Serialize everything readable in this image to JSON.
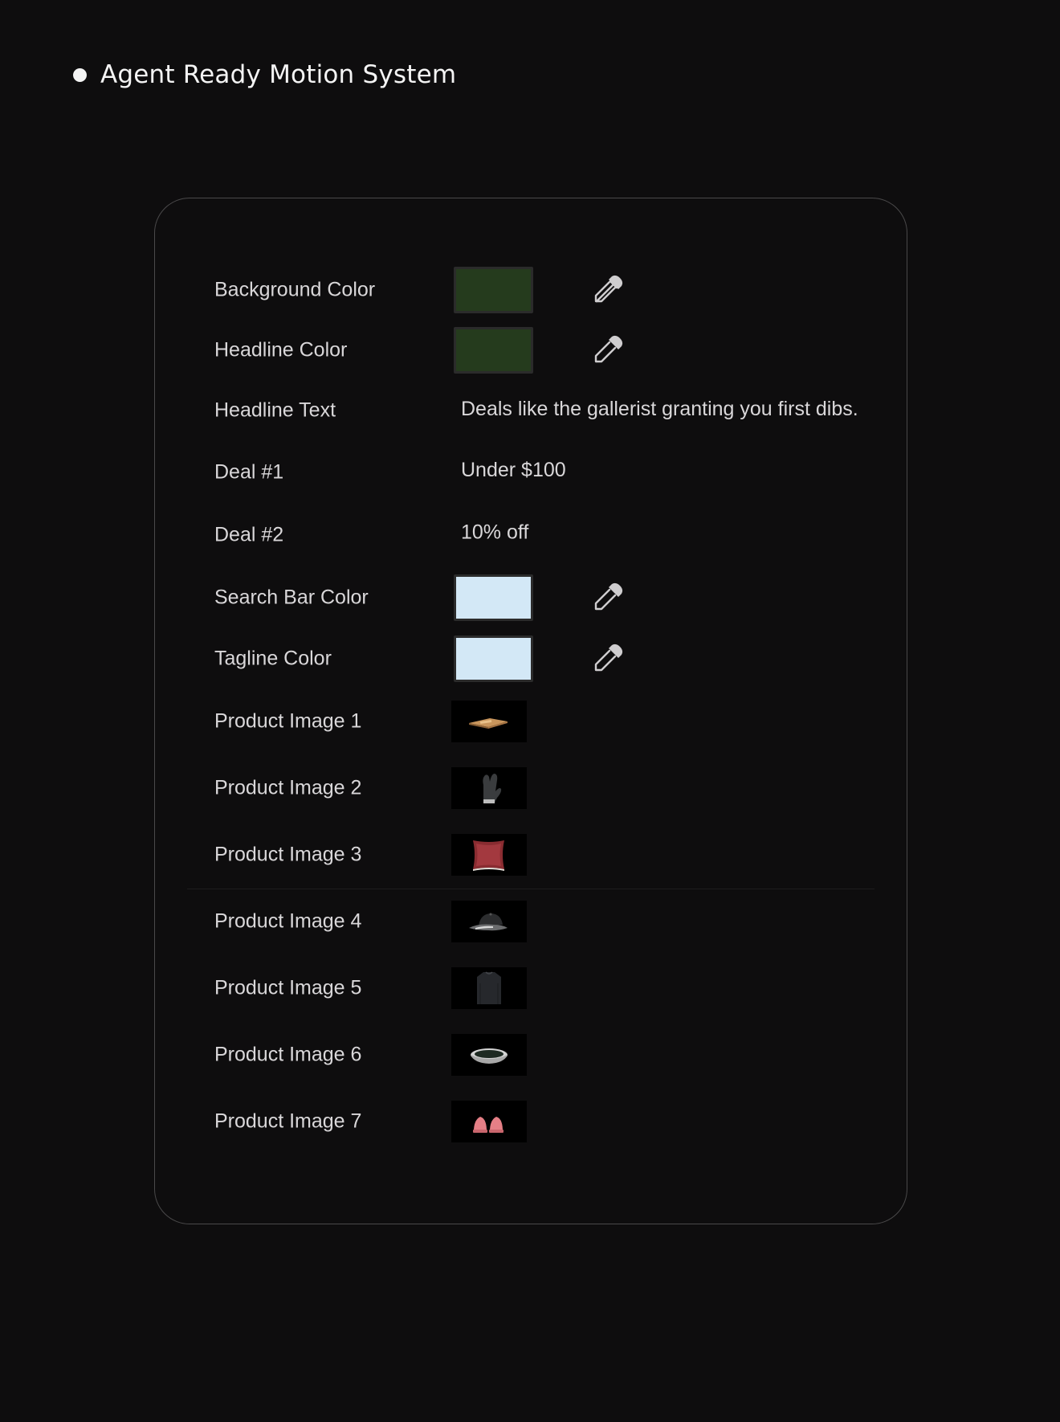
{
  "header": {
    "title": "Agent Ready Motion System"
  },
  "panel": {
    "rows": [
      {
        "label": "Background Color",
        "color": "#253b1d",
        "picker_icon": "eyedropper-icon"
      },
      {
        "label": "Headline Color",
        "color": "#253b1d",
        "picker_icon": "eyedropper-icon"
      },
      {
        "label": "Headline Text",
        "value": "Deals like the gallerist granting you first dibs."
      },
      {
        "label": "Deal #1",
        "value": "Under $100"
      },
      {
        "label": "Deal #2",
        "value": "10% off"
      },
      {
        "label": "Search Bar Color",
        "color": "#d3e8f6",
        "picker_icon": "eyedropper-icon"
      },
      {
        "label": "Tagline Color",
        "color": "#d3e8f6",
        "picker_icon": "eyedropper-icon"
      },
      {
        "label": "Product Image 1",
        "image": "cutting-board-thumbnail"
      },
      {
        "label": "Product Image 2",
        "image": "oven-mitt-thumbnail"
      },
      {
        "label": "Product Image 3",
        "image": "pillow-thumbnail"
      },
      {
        "label": "Product Image 4",
        "image": "cap-thumbnail"
      },
      {
        "label": "Product Image 5",
        "image": "sweater-thumbnail"
      },
      {
        "label": "Product Image 6",
        "image": "bowl-thumbnail"
      },
      {
        "label": "Product Image 7",
        "image": "slippers-thumbnail"
      }
    ]
  }
}
